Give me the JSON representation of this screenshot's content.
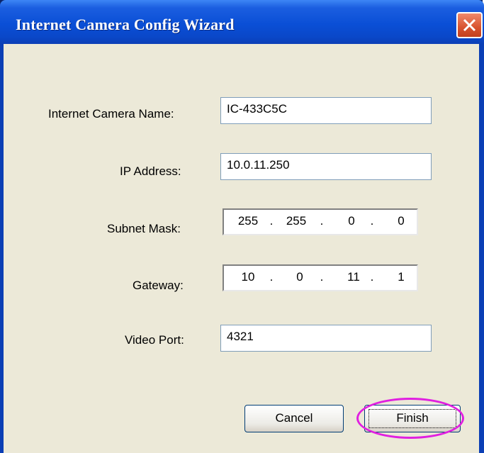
{
  "window": {
    "title": "Internet Camera Config Wizard",
    "close_icon": "close-icon"
  },
  "form": {
    "camera_name_label": "Internet Camera Name:",
    "camera_name_value": "IC-433C5C",
    "ip_label": "IP Address:",
    "ip_value": "10.0.11.250",
    "subnet_label": "Subnet Mask:",
    "subnet_octets": [
      "255",
      "255",
      "0",
      "0"
    ],
    "gateway_label": "Gateway:",
    "gateway_octets": [
      "10",
      "0",
      "11",
      "1"
    ],
    "video_port_label": "Video Port:",
    "video_port_value": "4321"
  },
  "buttons": {
    "cancel": "Cancel",
    "finish": "Finish"
  },
  "colors": {
    "titlebar": "#0a4fd6",
    "dialog_bg": "#ece9d8",
    "highlight": "#e020e0"
  }
}
